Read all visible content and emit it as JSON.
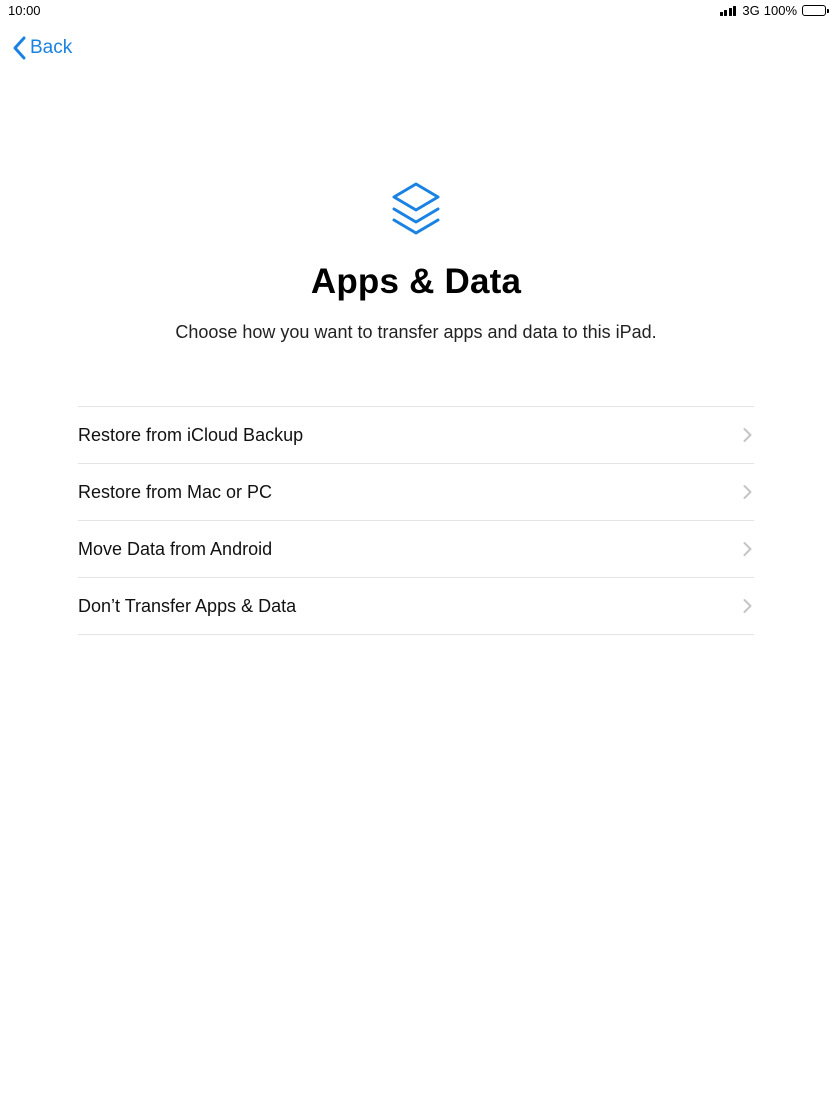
{
  "status_bar": {
    "time": "10:00",
    "network": "3G",
    "battery": "100%"
  },
  "nav": {
    "back_label": "Back"
  },
  "header": {
    "icon": "stacked-layers-icon",
    "title": "Apps & Data",
    "subtitle": "Choose how you want to transfer apps and data to this iPad."
  },
  "options": [
    {
      "label": "Restore from iCloud Backup"
    },
    {
      "label": "Restore from Mac or PC"
    },
    {
      "label": "Move Data from Android"
    },
    {
      "label": "Don’t Transfer Apps & Data"
    }
  ],
  "colors": {
    "accent": "#1a82e2",
    "separator": "#e3e3e6",
    "chevron": "#c4c4c9"
  }
}
